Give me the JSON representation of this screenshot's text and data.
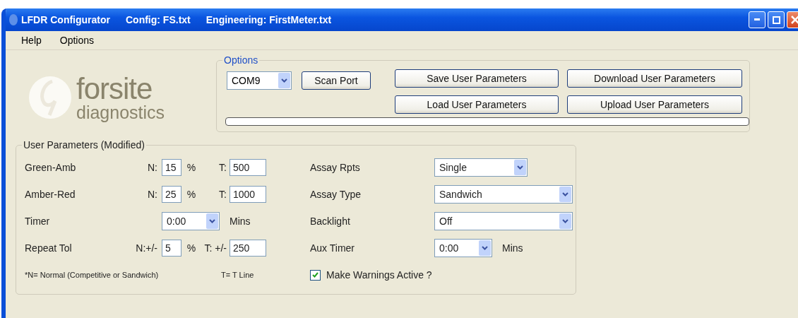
{
  "window": {
    "title_parts": [
      "LFDR Configurator",
      "Config:  FS.txt",
      "Engineering: FirstMeter.txt"
    ]
  },
  "menu": [
    {
      "label": "Help"
    },
    {
      "label": "Options"
    }
  ],
  "logo": {
    "name": "forsite",
    "tagline": "diagnostics"
  },
  "options": {
    "title": "Options",
    "port": {
      "value": "COM9"
    },
    "scan_button": "Scan Port",
    "buttons": [
      {
        "label": "Save User Parameters"
      },
      {
        "label": "Download User Parameters"
      },
      {
        "label": "Load User Parameters"
      },
      {
        "label": "Upload User Parameters"
      }
    ],
    "progress": {
      "level": 0
    }
  },
  "params": {
    "title": "User Parameters (Modified)",
    "left_rows": [
      {
        "kind": "threshold",
        "label": "Green-Amb",
        "n_label": "N:",
        "n_value": "15",
        "unit": "%",
        "t_label": "T:",
        "t_value": "500"
      },
      {
        "kind": "threshold",
        "label": "Amber-Red",
        "n_label": "N:",
        "n_value": "25",
        "unit": "%",
        "t_label": "T:",
        "t_value": "1000"
      },
      {
        "kind": "timer",
        "label": "Timer",
        "value": "0:00",
        "unit": "Mins"
      },
      {
        "kind": "threshold",
        "label": "Repeat Tol",
        "n_label": "N:+/-",
        "n_value": "5",
        "unit": "%",
        "t_label": "T: +/-",
        "t_value": "250"
      }
    ],
    "right_rows": [
      {
        "kind": "short",
        "label": "Assay Rpts",
        "value": "Single"
      },
      {
        "kind": "wide",
        "label": "Assay Type",
        "value": "Sandwich"
      },
      {
        "kind": "wide",
        "label": "Backlight",
        "value": "Off"
      },
      {
        "kind": "timer",
        "label": "Aux Timer",
        "value": "0:00",
        "unit": "Mins"
      }
    ],
    "footnote": "*N= Normal (Competitive or Sandwich)",
    "footnote_t": "T= T Line",
    "warnings": {
      "label": "Make Warnings Active ?",
      "checked": true
    }
  }
}
